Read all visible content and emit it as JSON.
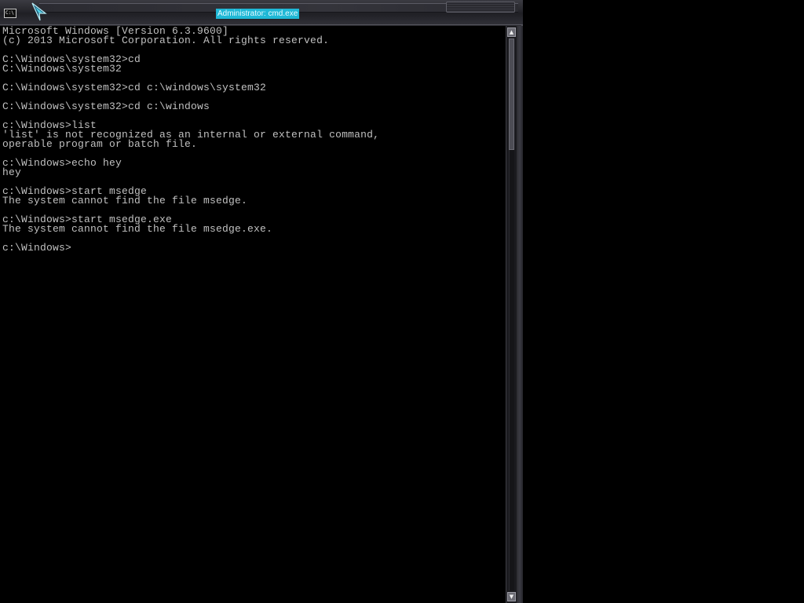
{
  "window": {
    "title": "Administrator: cmd.exe",
    "icon_label": "C:\\",
    "accent_color": "#1fb8d6"
  },
  "console": {
    "lines": [
      "Microsoft Windows [Version 6.3.9600]",
      "(c) 2013 Microsoft Corporation. All rights reserved.",
      "",
      "C:\\Windows\\system32>cd",
      "C:\\Windows\\system32",
      "",
      "C:\\Windows\\system32>cd c:\\windows\\system32",
      "",
      "C:\\Windows\\system32>cd c:\\windows",
      "",
      "c:\\Windows>list",
      "'list' is not recognized as an internal or external command,",
      "operable program or batch file.",
      "",
      "c:\\Windows>echo hey",
      "hey",
      "",
      "c:\\Windows>start msedge",
      "The system cannot find the file msedge.",
      "",
      "c:\\Windows>start msedge.exe",
      "The system cannot find the file msedge.exe.",
      "",
      "c:\\Windows>"
    ]
  },
  "scrollbar": {
    "up_icon": "scroll-up-arrow-icon",
    "down_icon": "scroll-down-arrow-icon",
    "up_glyph": "▲",
    "down_glyph": "▼"
  }
}
